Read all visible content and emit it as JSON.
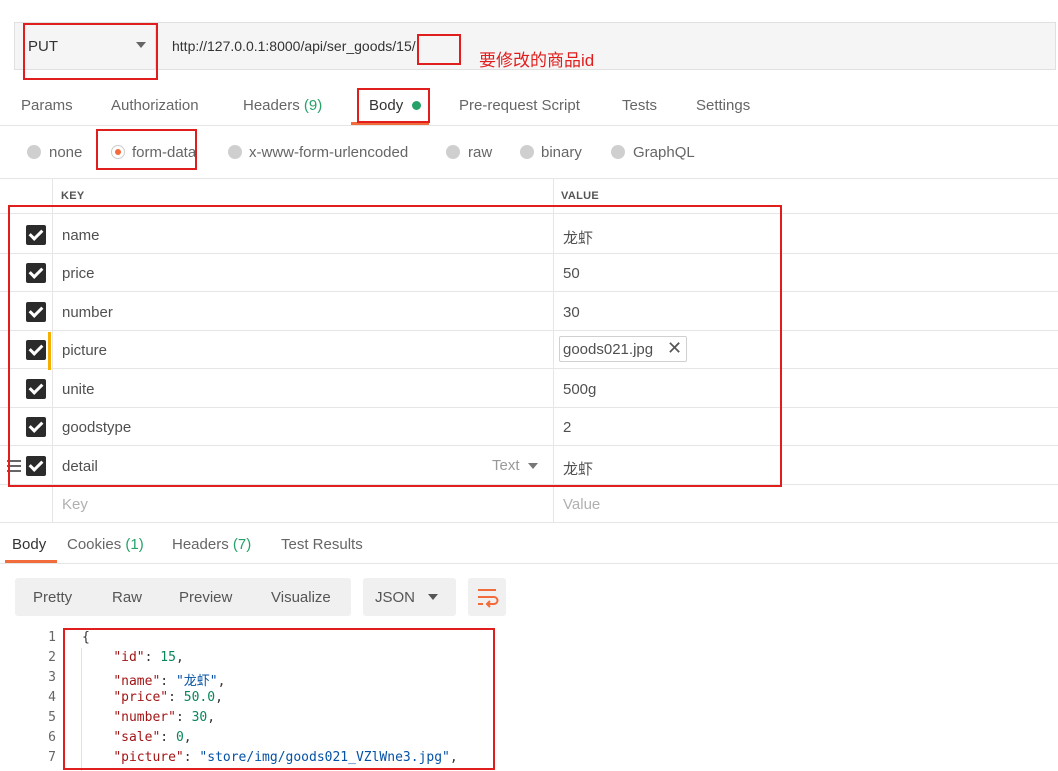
{
  "request": {
    "method": "PUT",
    "url": "http://127.0.0.1:8000/api/ser_goods/15/",
    "annotation": "要修改的商品id"
  },
  "tabs": [
    {
      "label": "Params"
    },
    {
      "label": "Authorization"
    },
    {
      "label": "Headers",
      "count": "(9)"
    },
    {
      "label": "Body"
    },
    {
      "label": "Pre-request Script"
    },
    {
      "label": "Tests"
    },
    {
      "label": "Settings"
    }
  ],
  "body_types": [
    "none",
    "form-data",
    "x-www-form-urlencoded",
    "raw",
    "binary",
    "GraphQL"
  ],
  "table": {
    "key_header": "KEY",
    "value_header": "VALUE",
    "rows": [
      {
        "key": "name",
        "value": "龙虾"
      },
      {
        "key": "price",
        "value": "50"
      },
      {
        "key": "number",
        "value": "30"
      },
      {
        "key": "picture",
        "value": "goods021.jpg"
      },
      {
        "key": "unite",
        "value": "500g"
      },
      {
        "key": "goodstype",
        "value": "2"
      },
      {
        "key": "detail",
        "value": "龙虾",
        "type": "Text"
      }
    ],
    "key_placeholder": "Key",
    "value_placeholder": "Value"
  },
  "response": {
    "tabs": [
      {
        "label": "Body"
      },
      {
        "label": "Cookies",
        "count": "(1)"
      },
      {
        "label": "Headers",
        "count": "(7)"
      },
      {
        "label": "Test Results"
      }
    ],
    "views": [
      "Pretty",
      "Raw",
      "Preview",
      "Visualize"
    ],
    "format": "JSON",
    "lines": [
      {
        "n": "1",
        "k": "",
        "v": "",
        "raw": "{"
      },
      {
        "n": "2",
        "k": "\"id\"",
        "v": "15",
        "t": "num"
      },
      {
        "n": "3",
        "k": "\"name\"",
        "v": "\"龙虾\"",
        "t": "str"
      },
      {
        "n": "4",
        "k": "\"price\"",
        "v": "50.0",
        "t": "num"
      },
      {
        "n": "5",
        "k": "\"number\"",
        "v": "30",
        "t": "num"
      },
      {
        "n": "6",
        "k": "\"sale\"",
        "v": "0",
        "t": "num"
      },
      {
        "n": "7",
        "k": "\"picture\"",
        "v": "\"store/img/goods021_VZlWne3.jpg\"",
        "t": "str"
      }
    ]
  }
}
